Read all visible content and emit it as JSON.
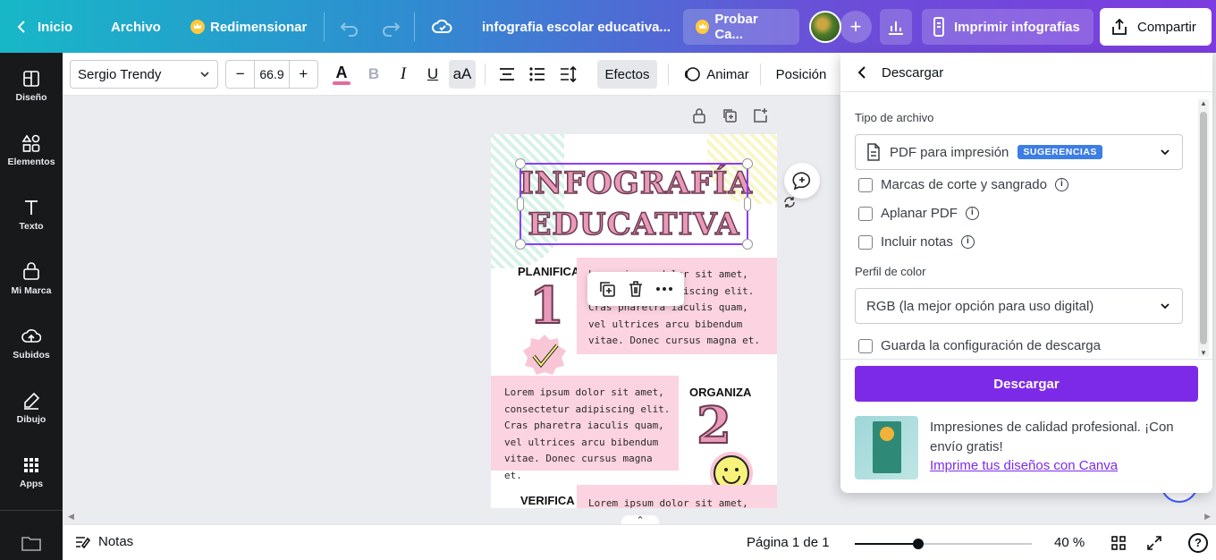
{
  "topbar": {
    "home_label": "Inicio",
    "file_label": "Archivo",
    "resize_label": "Redimensionar",
    "doc_title": "infografia escolar educativa...",
    "try_label": "Probar Ca...",
    "print_label": "Imprimir infografías",
    "share_label": "Compartir",
    "gradient_start": "#18b7c7",
    "gradient_end": "#7d3cdf"
  },
  "rail": {
    "items": [
      {
        "label": "Diseño",
        "icon": "layout-icon"
      },
      {
        "label": "Elementos",
        "icon": "shapes-icon"
      },
      {
        "label": "Texto",
        "icon": "text-icon"
      },
      {
        "label": "Mi Marca",
        "icon": "brand-icon"
      },
      {
        "label": "Subidos",
        "icon": "upload-icon"
      },
      {
        "label": "Dibujo",
        "icon": "draw-icon"
      },
      {
        "label": "Apps",
        "icon": "apps-icon"
      }
    ]
  },
  "toolbar": {
    "font_name": "Sergio Trendy",
    "font_size": "66.9",
    "minus": "−",
    "plus": "+",
    "color_glyph": "A",
    "bold_glyph": "B",
    "italic_glyph": "I",
    "underline_glyph": "U",
    "case_glyph": "aA",
    "effects_label": "Efectos",
    "animate_label": "Animar",
    "position_label": "Posición"
  },
  "design": {
    "title_line1": "INFOGRAFÍA",
    "title_line2": "EDUCATIVA",
    "step1_label": "PLANIFICA",
    "step1_num": "1",
    "step1_text": "Lorem ipsum dolor sit amet, consectetur adipiscing elit. Cras pharetra iaculis quam, vel ultrices arcu bibendum vitae. Donec cursus magna et.",
    "step2_label": "ORGANIZA",
    "step2_num": "2",
    "step2_text": "Lorem ipsum dolor sit amet, consectetur adipiscing elit. Cras pharetra iaculis quam, vel ultrices arcu bibendum vitae. Donec cursus magna et.",
    "step3_label": "VERIFICA",
    "step3_text": "Lorem ipsum dolor sit amet,",
    "accent_pink": "#fcd3e0",
    "title_pink": "#e89ab8"
  },
  "bottombar": {
    "notes_label": "Notas",
    "page_label": "Página 1 de 1",
    "zoom_label": "40 %",
    "zoom_fraction": 0.36,
    "help_glyph": "?"
  },
  "download_panel": {
    "title": "Descargar",
    "file_type_label": "Tipo de archivo",
    "file_type_value": "PDF para impresión",
    "file_type_badge": "SUGERENCIAS",
    "options": [
      {
        "label": "Marcas de corte y sangrado",
        "checked": false,
        "info": true
      },
      {
        "label": "Aplanar PDF",
        "checked": false,
        "info": true
      },
      {
        "label": "Incluir notas",
        "checked": false,
        "info": true
      }
    ],
    "color_profile_label": "Perfil de color",
    "color_profile_value": "RGB (la mejor opción para uso digital)",
    "save_config_label": "Guarda la configuración de descarga",
    "download_button": "Descargar",
    "promo_text": "Impresiones de calidad profesional. ¡Con envío gratis!",
    "promo_link": "Imprime tus diseños con Canva",
    "button_color": "#7d2ae8"
  }
}
